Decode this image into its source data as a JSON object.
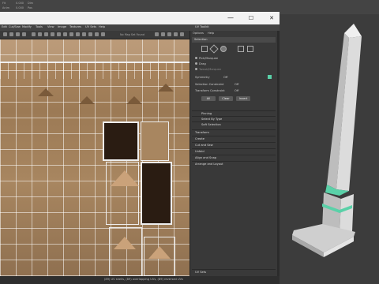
{
  "background": {
    "top_labels": [
      "Fit",
      "Anim",
      "Dim",
      "Pos",
      "Fill"
    ],
    "top_values": [
      "0.000",
      "0.000",
      "0.000",
      "0.000",
      "0.000"
    ]
  },
  "window": {
    "minimize": "—",
    "maximize": "☐",
    "close": "✕"
  },
  "menubar": {
    "items": [
      "Edit",
      "Cut/Sew",
      "Modify",
      "Tools",
      "View",
      "Image",
      "Textures",
      "UV Sets",
      "Help"
    ]
  },
  "toolbar": {
    "uv_set": "No Map Set Found"
  },
  "status": {
    "text": "(89) UV shells, (89) overlapping UVs, (89) reversed UVs"
  },
  "toolkit": {
    "title": "UV Toolkit",
    "menu": [
      "Options",
      "Help"
    ],
    "selection_header": "Selection",
    "select_modes": [
      "Pick/Marquee",
      "Drag",
      "Tweak/Marquee"
    ],
    "symmetry_label": "Symmetry",
    "symmetry_value": "Off",
    "sel_constraint_label": "Selection Constraint",
    "sel_constraint_value": "Off",
    "transform_constraint_label": "Transform Constraint",
    "transform_constraint_value": "Off",
    "buttons": [
      "All",
      "Clear",
      "Invert"
    ],
    "sub_sections": [
      "Pinning",
      "Select By Type",
      "Soft Selection"
    ],
    "sections": [
      "Transform",
      "Create",
      "Cut and Sew",
      "Unfold",
      "Align and Snap",
      "Arrange and Layout"
    ],
    "footer": "UV Sets"
  },
  "colors": {
    "accent": "#5ad1a8",
    "obelisk": "#d9d9d9"
  }
}
